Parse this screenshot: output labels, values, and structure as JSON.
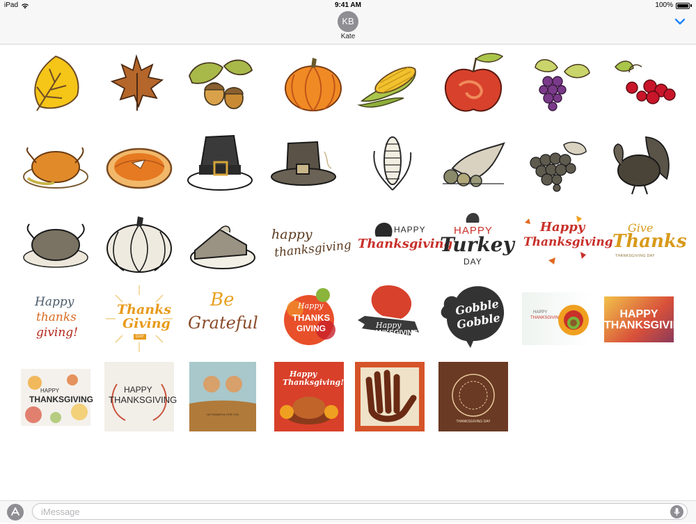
{
  "status_bar": {
    "device": "iPad",
    "time": "9:41 AM",
    "battery": "100%"
  },
  "header": {
    "avatar_initials": "KB",
    "contact_name": "Kate"
  },
  "stickers": {
    "row1": [
      "yellow-leaf",
      "maple-leaf",
      "oak-leaf-acorns",
      "pumpkin",
      "corn",
      "apple",
      "grapes",
      "berries"
    ],
    "row2": [
      "roast-turkey",
      "pumpkin-pie",
      "pilgrim-hat-black",
      "pilgrim-hat-sketch",
      "corn-sketch",
      "cornucopia",
      "grapes-sketch",
      "turkey-sketch"
    ],
    "row3": [
      "roast-turkey-sketch",
      "pumpkin-sketch",
      "pie-slice-sketch",
      "happy-thanksgiving-handwritten",
      "happy-thanksgiving-turkey",
      "happy-turkey-day",
      "happy-thanksgiving-red-script",
      "give-thanks"
    ],
    "row4": [
      "happy-thanks-giving-wreath",
      "thanks-giving-day-burst",
      "be-grateful",
      "happy-thanksgiving-watercolor",
      "happy-thanksgiving-banner",
      "gobble-gobble",
      "happy-thanksgiving-card-turkey",
      "happy-thanksgiving-bokeh"
    ],
    "row5": [
      "happy-thanksgiving-leaves",
      "happy-thanksgiving-wreath-card",
      "thankful-hands",
      "happy-thanksgiving-dinner",
      "turkey-hand",
      "thanksgiving-day-doodle"
    ]
  },
  "sticker_text": {
    "s28": [
      "happy",
      "thanksgiving"
    ],
    "s29_happy": "HAPPY",
    "s29_script": "Thanksgiving",
    "s30": [
      "HAPPY",
      "Turkey",
      "DAY"
    ],
    "s31": [
      "Happy",
      "Thanksgiving"
    ],
    "s32": [
      "Give",
      "Thanks",
      "THANKSGIVING DAY"
    ],
    "s33": [
      "Happy",
      "thanks",
      "giving!"
    ],
    "s34": [
      "Thanks",
      "Giving",
      "DAY"
    ],
    "s35": [
      "Be",
      "Grateful"
    ],
    "s36": [
      "Happy",
      "THANKS",
      "GIVING"
    ],
    "s37": [
      "Happy",
      "THANKSGIVING"
    ],
    "s38": [
      "Gobble",
      "Gobble"
    ],
    "s39": [
      "HAPPY",
      "THANKSGIVING"
    ],
    "s40": "HAPPY THANKSGIVING",
    "s41": [
      "HAPPY",
      "THANKSGIVING"
    ],
    "s42": [
      "HAPPY",
      "THANKSGIVING"
    ],
    "s43": "I'M THANKFUL FOR YOU",
    "s44": [
      "Happy",
      "Thanksgiving!"
    ],
    "s46": "THANKSGIVING DAY"
  },
  "input": {
    "placeholder": "iMessage",
    "value": ""
  },
  "icons": {
    "wifi": "wifi-icon",
    "battery": "battery-icon",
    "collapse": "chevron-down-icon",
    "app_store": "app-store-icon",
    "microphone": "microphone-icon"
  },
  "colors": {
    "accent": "#1a82fb",
    "gray_button": "#8e8e93",
    "bar_background": "#f7f7f7"
  }
}
